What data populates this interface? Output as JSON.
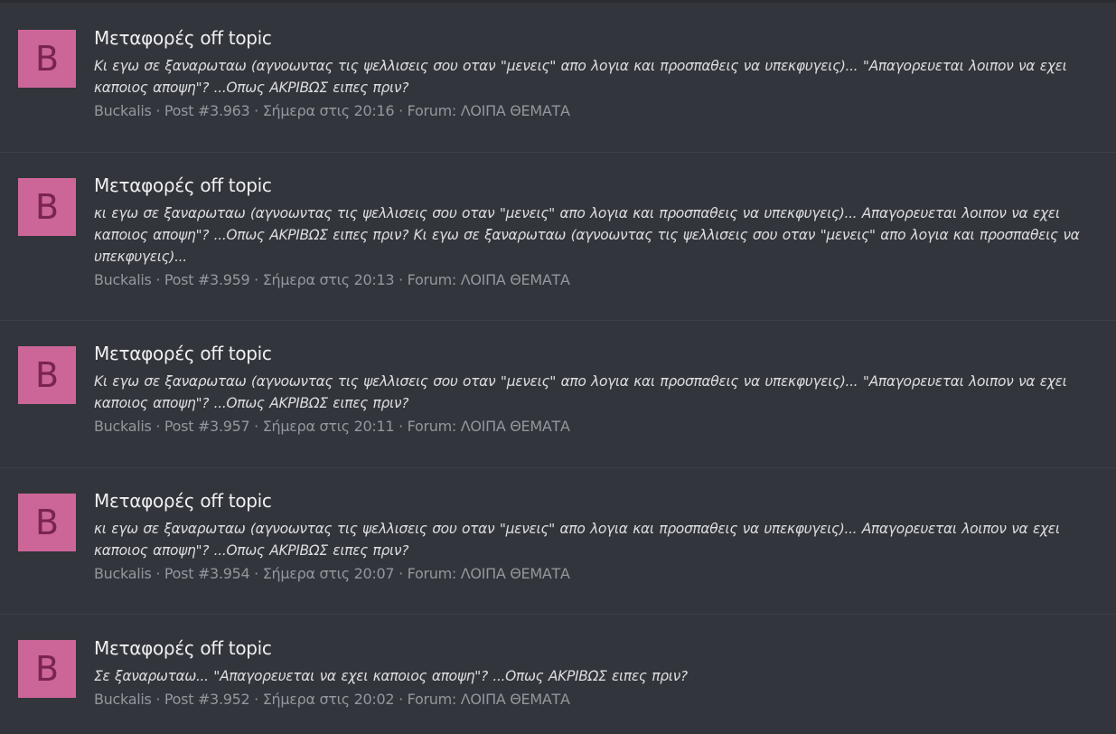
{
  "results": [
    {
      "avatar_letter": "B",
      "title": "Μεταφορές off topic",
      "snippet": "Κι εγω σε ξαναρωταω (αγνοωντας τις ψελλισεις σου οταν \"μενεις\" απο λογια και προσπαθεις να υπεκφυγεις)... \"Απαγορευεται λοιπον να εχει καποιος αποψη\"? ...Οπως ΑΚΡΙΒΩΣ ειπες πριν?",
      "author": "Buckalis",
      "post": "Post #3.963",
      "time": "Σήμερα στις 20:16",
      "forum": "Forum: ΛΟΙΠΑ ΘΕΜΑΤΑ"
    },
    {
      "avatar_letter": "B",
      "title": "Μεταφορές off topic",
      "snippet": "κι εγω σε ξαναρωταω (αγνοωντας τις ψελλισεις σου οταν \"μενεις\" απο λογια και προσπαθεις να υπεκφυγεις)... Απαγορευεται λοιπον να εχει καποιος αποψη\"? ...Οπως ΑΚΡΙΒΩΣ ειπες πριν? Κι εγω σε ξαναρωταω (αγνοωντας τις ψελλισεις σου οταν \"μενεις\" απο λογια και προσπαθεις να υπεκφυγεις)...",
      "author": "Buckalis",
      "post": "Post #3.959",
      "time": "Σήμερα στις 20:13",
      "forum": "Forum: ΛΟΙΠΑ ΘΕΜΑΤΑ"
    },
    {
      "avatar_letter": "B",
      "title": "Μεταφορές off topic",
      "snippet": "Κι εγω σε ξαναρωταω (αγνοωντας τις ψελλισεις σου οταν \"μενεις\" απο λογια και προσπαθεις να υπεκφυγεις)... \"Απαγορευεται λοιπον να εχει καποιος αποψη\"? ...Οπως ΑΚΡΙΒΩΣ ειπες πριν?",
      "author": "Buckalis",
      "post": "Post #3.957",
      "time": "Σήμερα στις 20:11",
      "forum": "Forum: ΛΟΙΠΑ ΘΕΜΑΤΑ"
    },
    {
      "avatar_letter": "B",
      "title": "Μεταφορές off topic",
      "snippet": "κι εγω σε ξαναρωταω (αγνοωντας τις ψελλισεις σου οταν \"μενεις\" απο λογια και προσπαθεις να υπεκφυγεις)... Απαγορευεται λοιπον να εχει καποιος αποψη\"? ...Οπως ΑΚΡΙΒΩΣ ειπες πριν?",
      "author": "Buckalis",
      "post": "Post #3.954",
      "time": "Σήμερα στις 20:07",
      "forum": "Forum: ΛΟΙΠΑ ΘΕΜΑΤΑ"
    },
    {
      "avatar_letter": "B",
      "title": "Μεταφορές off topic",
      "snippet": "Σε ξαναρωταω... \"Απαγορευεται να εχει καποιος αποψη\"? ...Οπως ΑΚΡΙΒΩΣ ειπες πριν?",
      "author": "Buckalis",
      "post": "Post #3.952",
      "time": "Σήμερα στις 20:02",
      "forum": "Forum: ΛΟΙΠΑ ΘΕΜΑΤΑ"
    }
  ],
  "meta_separator": " · ",
  "colors": {
    "background": "#32353b",
    "avatar_bg": "#cc6699",
    "avatar_letter": "#7a2450",
    "title": "#f0f0f2",
    "snippet": "#dcdde0",
    "meta": "#94979d"
  }
}
